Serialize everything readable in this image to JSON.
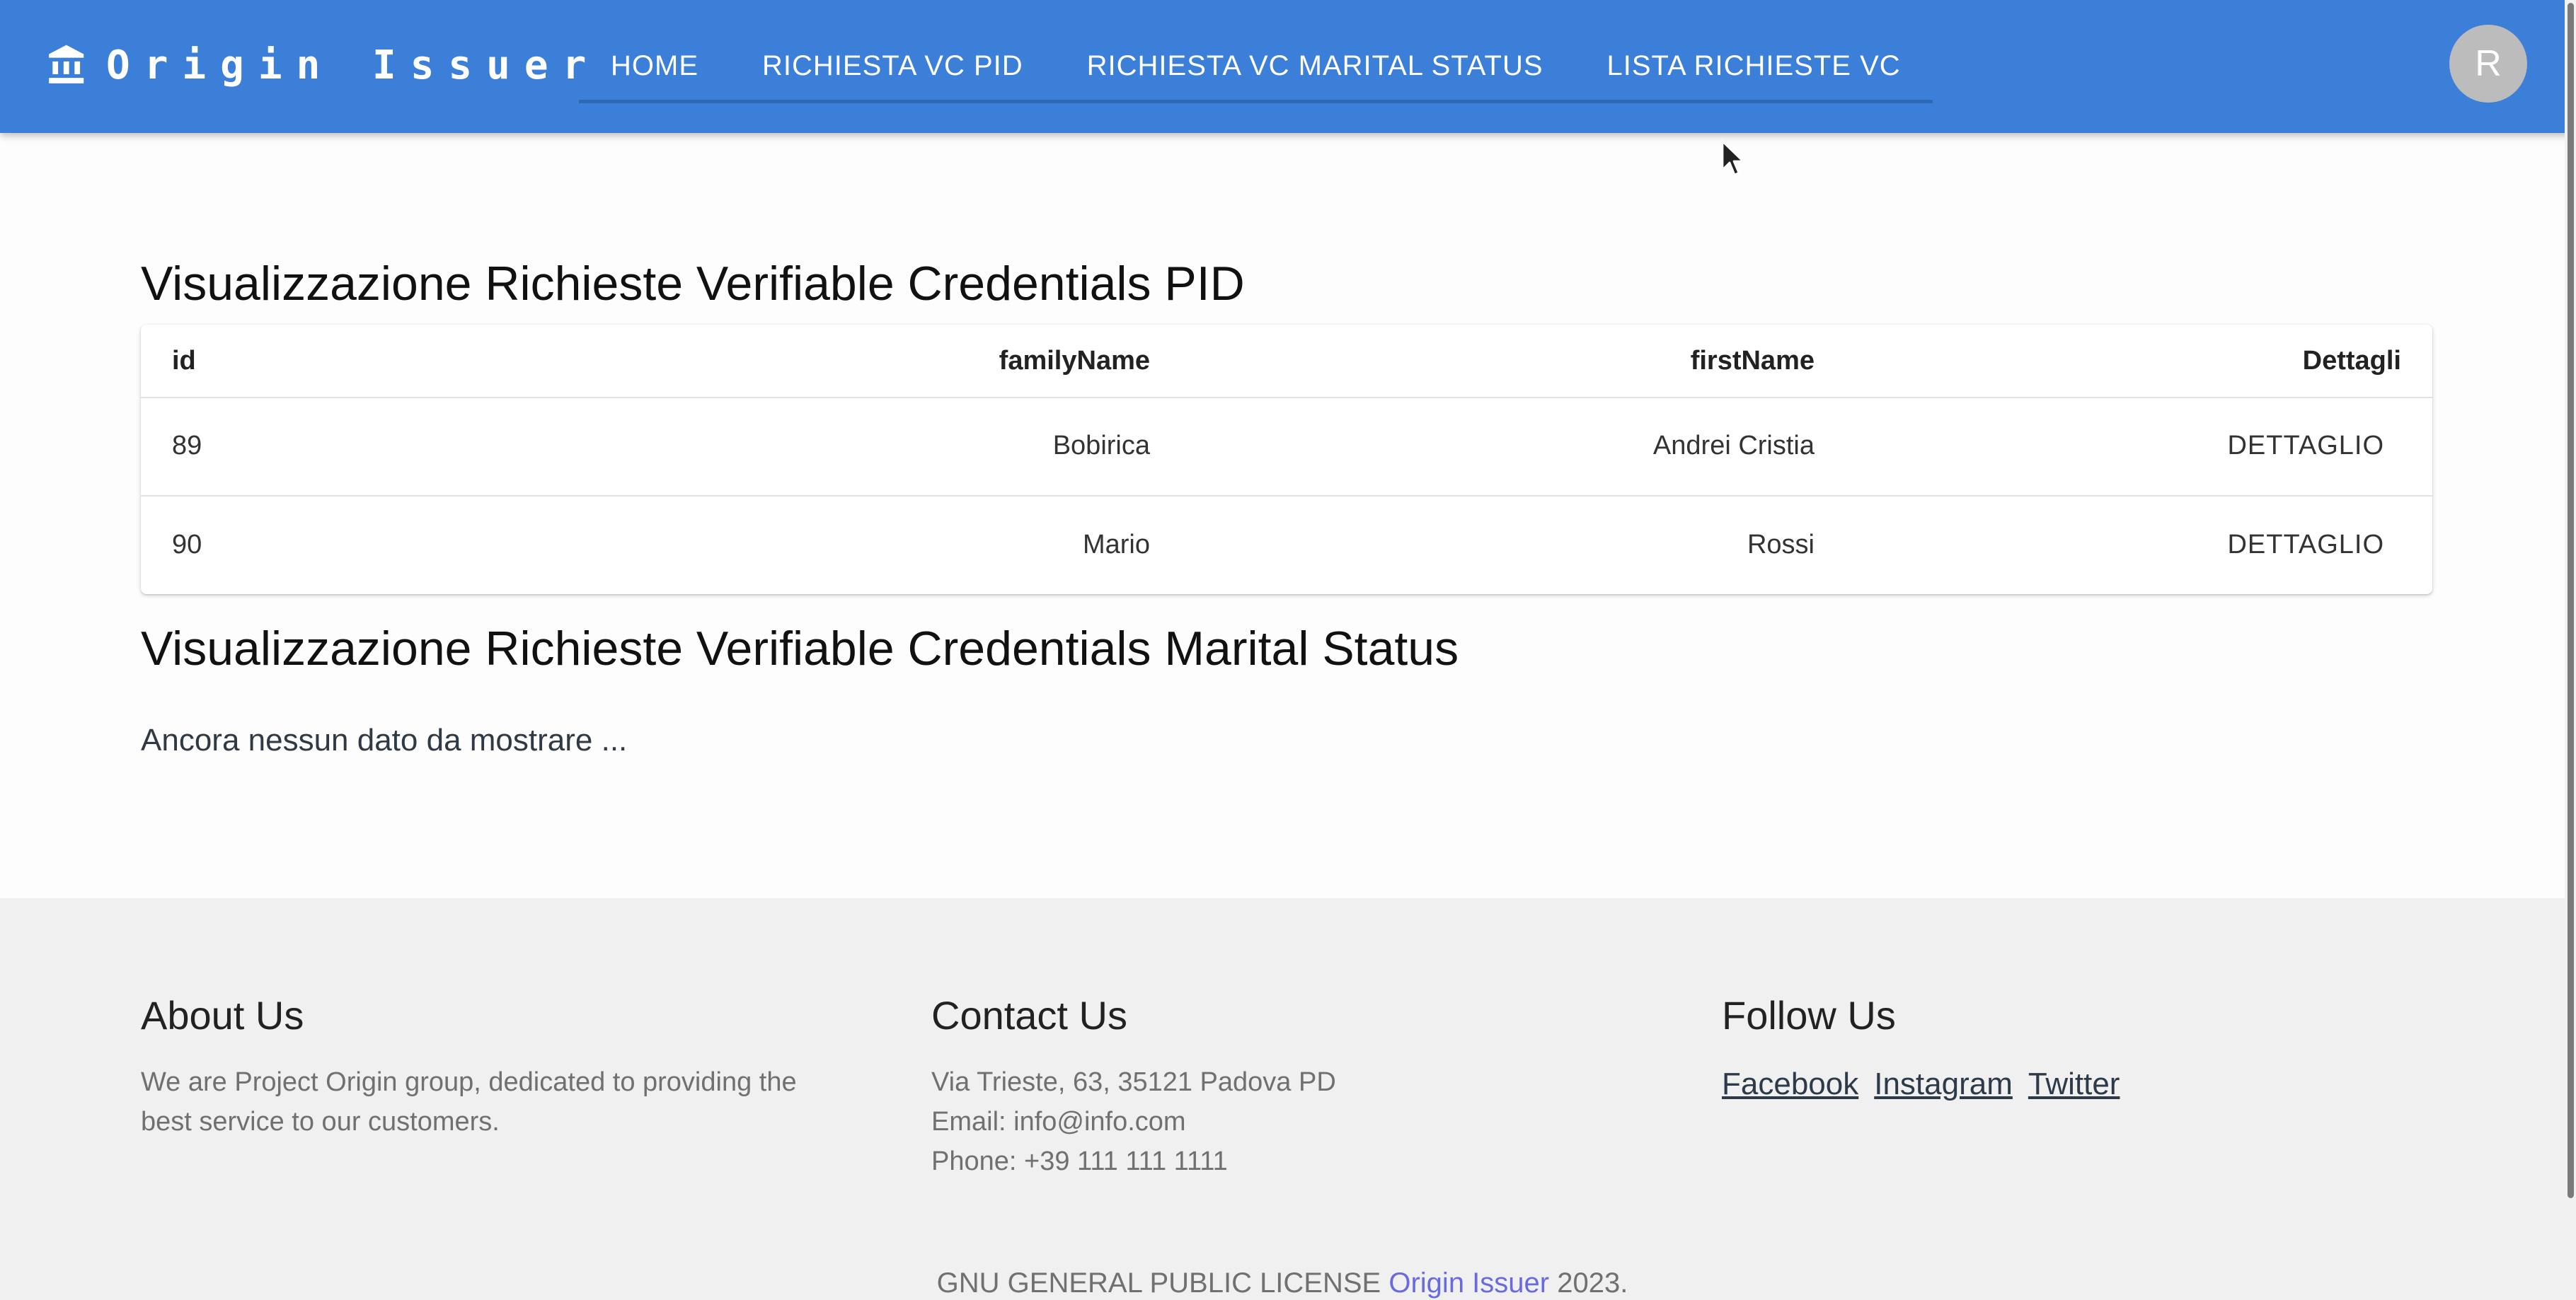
{
  "header": {
    "brand_title": "Origin Issuer",
    "brand_icon": "bank-icon",
    "nav": [
      {
        "label": "HOME"
      },
      {
        "label": "RICHIESTA VC PID"
      },
      {
        "label": "RICHIESTA VC MARITAL STATUS"
      },
      {
        "label": "LISTA RICHIESTE VC"
      }
    ],
    "avatar_initial": "R"
  },
  "main": {
    "pid_title": "Visualizzazione Richieste Verifiable Credentials PID",
    "pid_table": {
      "columns": [
        "id",
        "familyName",
        "firstName",
        "Dettagli"
      ],
      "rows": [
        {
          "id": "89",
          "familyName": "Bobirica",
          "firstName": "Andrei Cristia",
          "action": "DETTAGLIO"
        },
        {
          "id": "90",
          "familyName": "Mario",
          "firstName": "Rossi",
          "action": "DETTAGLIO"
        }
      ]
    },
    "marital_title": "Visualizzazione Richieste Verifiable Credentials Marital Status",
    "marital_empty": "Ancora nessun dato da mostrare ..."
  },
  "footer": {
    "about": {
      "title": "About Us",
      "text": "We are Project Origin group, dedicated to providing the best service to our customers."
    },
    "contact": {
      "title": "Contact Us",
      "address": "Via Trieste, 63, 35121 Padova PD",
      "email": "Email: info@info.com",
      "phone": "Phone: +39 111 111 1111"
    },
    "follow": {
      "title": "Follow Us",
      "links": [
        "Facebook",
        "Instagram",
        "Twitter"
      ]
    },
    "copyright": {
      "prefix": "GNU GENERAL PUBLIC LICENSE",
      "brand": "Origin Issuer",
      "suffix": "2023."
    }
  },
  "colors": {
    "appbar": "#3b7fd8",
    "footer_bg": "#f0f0f0",
    "link_accent": "#6a6ae0"
  }
}
